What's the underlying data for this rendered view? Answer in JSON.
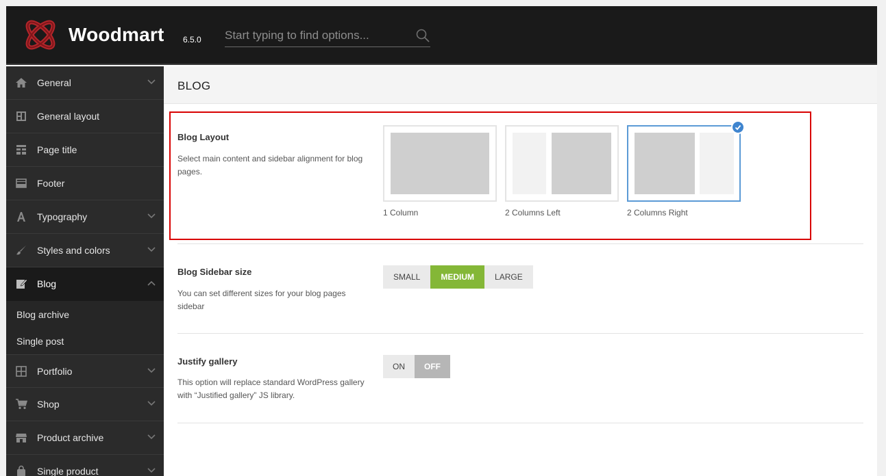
{
  "colors": {
    "header_bg": "#1a1a1a",
    "sidebar_bg": "#2b2b2b",
    "accent_green": "#84b737",
    "selected_blue": "#3f85cf",
    "highlight_red": "#d80000"
  },
  "header": {
    "brand": "Woodmart",
    "version": "6.5.0",
    "search_placeholder": "Start typing to find options..."
  },
  "sidebar": {
    "items": [
      {
        "label": "General",
        "icon": "home-icon",
        "has_chevron": true
      },
      {
        "label": "General layout",
        "icon": "layout-icon",
        "has_chevron": false
      },
      {
        "label": "Page title",
        "icon": "page-title-icon",
        "has_chevron": false
      },
      {
        "label": "Footer",
        "icon": "footer-icon",
        "has_chevron": false
      },
      {
        "label": "Typography",
        "icon": "typography-icon",
        "has_chevron": true
      },
      {
        "label": "Styles and colors",
        "icon": "brush-icon",
        "has_chevron": true
      },
      {
        "label": "Blog",
        "icon": "edit-icon",
        "has_chevron": true,
        "active": true
      },
      {
        "label": "Portfolio",
        "icon": "grid-icon",
        "has_chevron": true
      },
      {
        "label": "Shop",
        "icon": "cart-icon",
        "has_chevron": true
      },
      {
        "label": "Product archive",
        "icon": "store-icon",
        "has_chevron": true
      },
      {
        "label": "Single product",
        "icon": "bag-icon",
        "has_chevron": true
      }
    ],
    "blog_subitems": [
      "Blog archive",
      "Single post"
    ]
  },
  "main": {
    "page_title": "BLOG",
    "blog_layout": {
      "title": "Blog Layout",
      "description": "Select main content and sidebar alignment for blog pages.",
      "options": [
        "1 Column",
        "2 Columns Left",
        "2 Columns Right"
      ],
      "selected": "2 Columns Right"
    },
    "sidebar_size": {
      "title": "Blog Sidebar size",
      "description": "You can set different sizes for your blog pages sidebar",
      "options": [
        "SMALL",
        "MEDIUM",
        "LARGE"
      ],
      "selected": "MEDIUM"
    },
    "justify_gallery": {
      "title": "Justify gallery",
      "description": "This option will replace standard WordPress gallery with “Justified gallery” JS library.",
      "options": [
        "ON",
        "OFF"
      ],
      "selected": "OFF"
    }
  }
}
